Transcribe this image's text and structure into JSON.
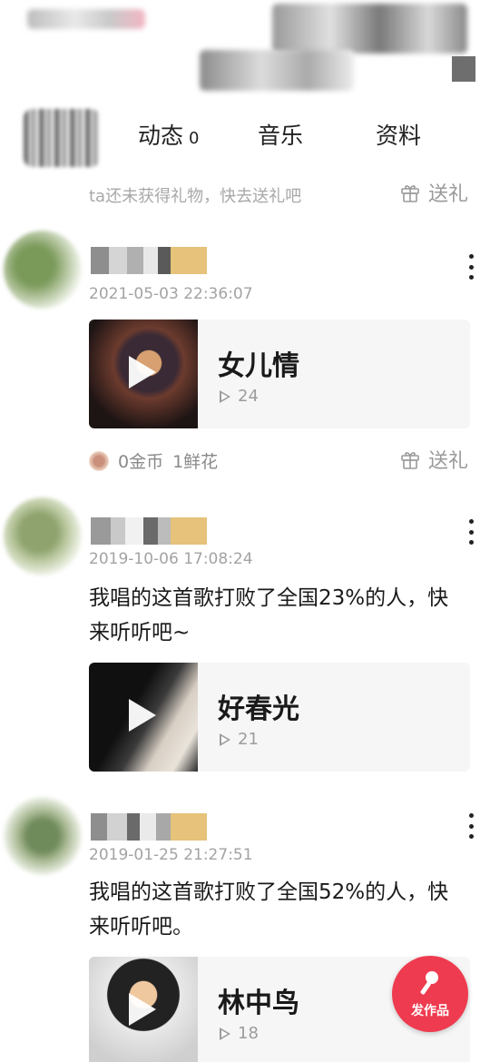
{
  "tabs": [
    {
      "label": "动态",
      "count": "0"
    },
    {
      "label": "音乐",
      "count": ""
    },
    {
      "label": "资料",
      "count": ""
    }
  ],
  "gift_bar": {
    "hint": "ta还未获得礼物，快去送礼吧",
    "button": "送礼"
  },
  "posts": [
    {
      "timestamp": "2021-05-03 22:36:07",
      "caption": "",
      "song": {
        "title": "女儿情",
        "plays": "24"
      },
      "stats": {
        "coins": "0金币",
        "flowers": "1鲜花",
        "gift_button": "送礼"
      }
    },
    {
      "timestamp": "2019-10-06 17:08:24",
      "caption": "我唱的这首歌打败了全国23%的人，快来听听吧~",
      "song": {
        "title": "好春光",
        "plays": "21"
      }
    },
    {
      "timestamp": "2019-01-25 21:27:51",
      "caption": "我唱的这首歌打败了全国52%的人，快来听听吧。",
      "song": {
        "title": "林中鸟",
        "plays": "18"
      }
    }
  ],
  "fab": {
    "label": "发作品"
  },
  "colors": {
    "accent": "#ef3b4f",
    "muted": "#a3a3a3"
  },
  "icons": [
    "gift-icon",
    "play-icon",
    "more-icon",
    "microphone-icon"
  ]
}
